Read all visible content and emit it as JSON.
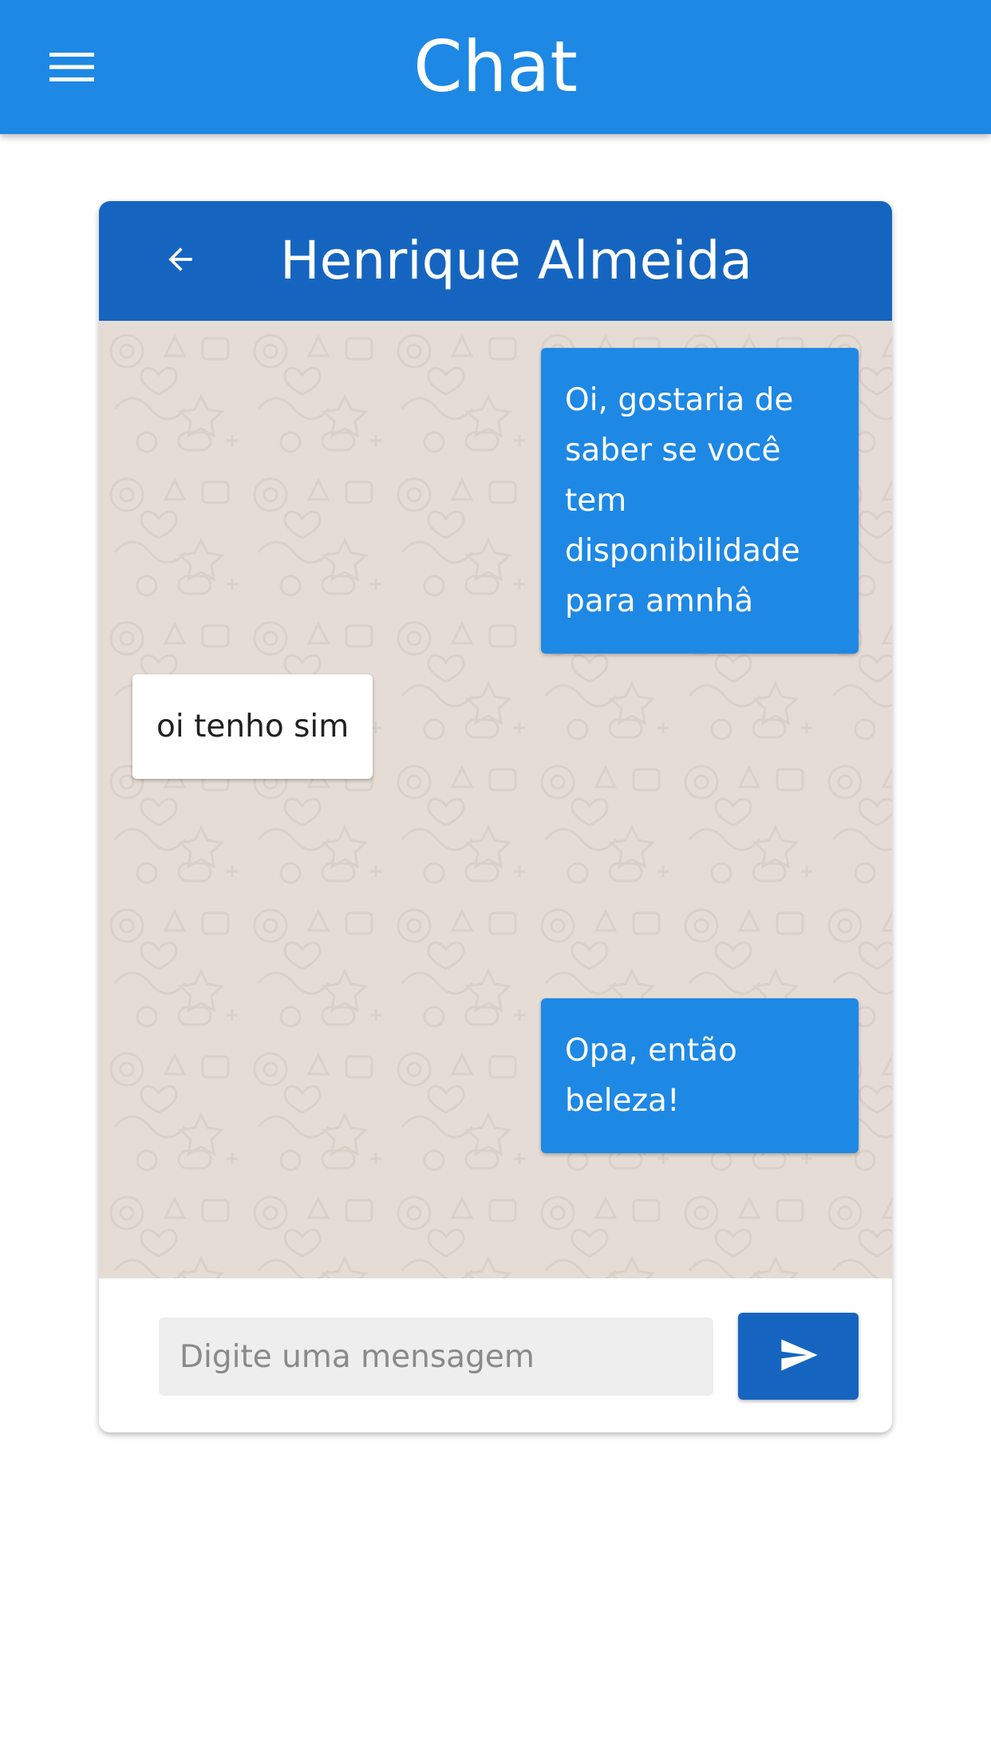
{
  "appbar": {
    "title": "Chat",
    "menu_icon": "menu-icon",
    "color": "#1e88e5"
  },
  "chat": {
    "contact_name": "Henrique Almeida",
    "back_icon": "arrow-back-icon",
    "header_color": "#1565c0",
    "background_color": "#e5ddd5",
    "messages": [
      {
        "direction": "sent",
        "text": "Oi, gostaria de saber se você tem disponibilidade para amnhâ"
      },
      {
        "direction": "received",
        "text": "oi tenho sim"
      },
      {
        "direction": "sent",
        "text": "Opa, então beleza!"
      }
    ]
  },
  "composer": {
    "placeholder": "Digite uma mensagem",
    "value": "",
    "send_icon": "send-icon"
  }
}
